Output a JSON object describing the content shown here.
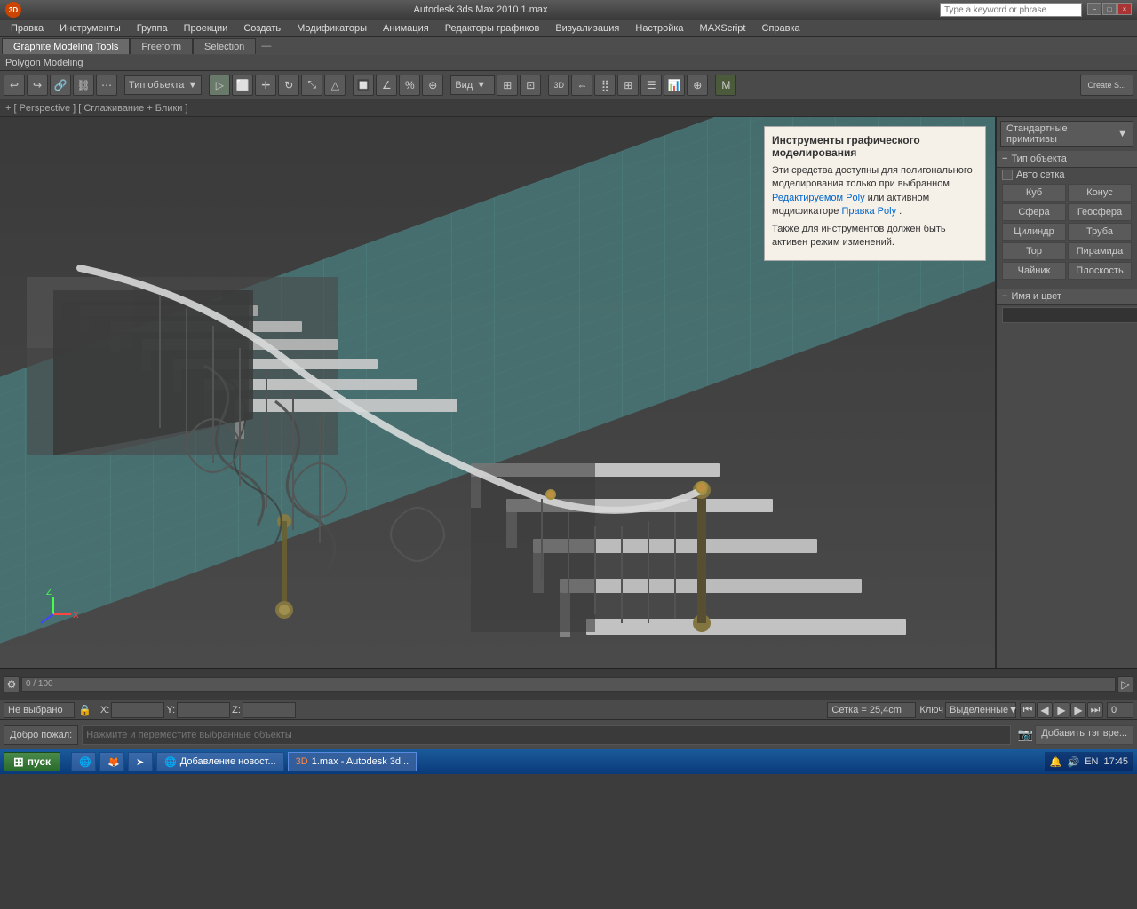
{
  "titlebar": {
    "title": "Autodesk 3ds Max 2010    1.max",
    "search_placeholder": "Type a keyword or phrase",
    "min_label": "−",
    "max_label": "□",
    "close_label": "×"
  },
  "menubar": {
    "items": [
      "Правка",
      "Инструменты",
      "Группа",
      "Проекции",
      "Создать",
      "Модификаторы",
      "Анимация",
      "Редакторы графиков",
      "Визуализация",
      "Настройка",
      "MAXScript",
      "Справка"
    ]
  },
  "toolbar_tabs": {
    "tabs": [
      "Graphite Modeling Tools",
      "Freeform",
      "Selection"
    ],
    "extra": "—"
  },
  "poly_bar": {
    "label": "Polygon Modeling"
  },
  "viewport": {
    "label": "+ [ Perspective ] [ Сглаживание + Блики ]",
    "orbit_label": "⊙"
  },
  "info_panel": {
    "title": "Инструменты графического моделирования",
    "body1": "Эти средства доступны для полигонального моделирования только при выбранном",
    "link1": "Редактируемом Poly",
    "body1b": "или активном модификаторе",
    "link2": "Правка Poly",
    "body1c": ".",
    "body2": "Также для инструментов должен быть активен режим изменений."
  },
  "right_panel": {
    "dropdown_label": "Стандартные примитивы",
    "section1": "Тип объекта",
    "auto_sew": "Авто сетка",
    "buttons": [
      "Куб",
      "Конус",
      "Сфера",
      "Геосфера",
      "Цилиндр",
      "Труба",
      "Тор",
      "Пирамида",
      "Чайник",
      "Плоскость"
    ],
    "section2": "Имя и цвет"
  },
  "timeline": {
    "position": "0 / 100"
  },
  "statusbar": {
    "no_selection": "Не выбрано",
    "x_label": "X:",
    "y_label": "Y:",
    "z_label": "Z:",
    "grid_label": "Сетка = 25,4cm",
    "key_label": "Ключ",
    "selected_label": "Выделенные"
  },
  "cmdbar": {
    "hint": "Нажмите и переместите выбранные объекты",
    "add_tag_label": "Добавить тэг вре...",
    "prompt_label": "Добро пожал:"
  },
  "taskbar": {
    "start_label": "пуск",
    "tasks": [
      "Добавление новост...",
      "1.max - Autodesk 3d..."
    ],
    "systray": {
      "lang": "EN",
      "time": "17:45"
    }
  }
}
